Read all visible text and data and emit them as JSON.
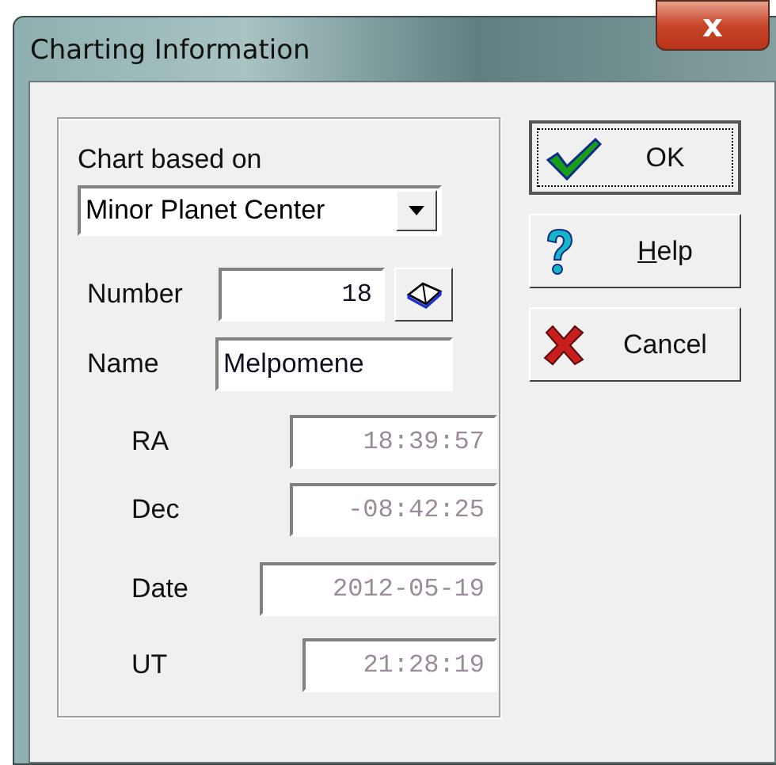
{
  "window": {
    "title": "Charting Information",
    "close": "x"
  },
  "group": {
    "label": "Chart based on",
    "source": {
      "value": "Minor Planet Center"
    },
    "fields": [
      {
        "label": "Number",
        "value": "18",
        "disabled": false,
        "kind": "number"
      },
      {
        "label": "Name",
        "value": "Melpomene",
        "disabled": false,
        "kind": "text"
      },
      {
        "label": "RA",
        "value": "18:39:57",
        "disabled": true,
        "kind": "number"
      },
      {
        "label": "Dec",
        "value": "-08:42:25",
        "disabled": true,
        "kind": "number"
      },
      {
        "label": "Date",
        "value": "2012-05-19",
        "disabled": true,
        "kind": "number"
      },
      {
        "label": "UT",
        "value": "21:28:19",
        "disabled": true,
        "kind": "number"
      }
    ]
  },
  "buttons": [
    {
      "label": "OK",
      "kind": "ok",
      "focused": true,
      "first_letter_underlined": false
    },
    {
      "label": "Help",
      "kind": "help",
      "focused": false,
      "first_letter_underlined": true
    },
    {
      "label": "Cancel",
      "kind": "cancel",
      "focused": false,
      "first_letter_underlined": false
    }
  ]
}
